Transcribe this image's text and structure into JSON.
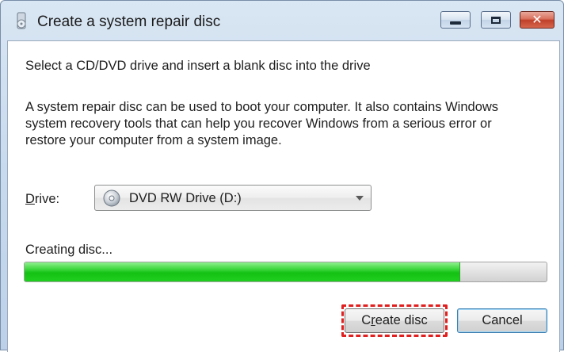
{
  "window": {
    "title": "Create a system repair disc",
    "icons": {
      "app": "disc-app-icon",
      "minimize": "minimize-icon",
      "maximize": "maximize-icon",
      "close": "close-icon"
    }
  },
  "content": {
    "heading": "Select a CD/DVD drive and insert a blank disc into the drive",
    "description": "A system repair disc can be used to boot your computer. It also contains Windows system recovery tools that can help you recover Windows from a serious error or restore your computer from a system image."
  },
  "drive": {
    "label_accel": "D",
    "label_rest": "rive:",
    "selected": "DVD RW Drive (D:)",
    "icon": "disc-drive-icon"
  },
  "progress": {
    "label": "Creating disc...",
    "fraction": 0.835
  },
  "buttons": {
    "create_prefix": "C",
    "create_accel": "r",
    "create_suffix": "eate disc",
    "cancel": "Cancel"
  },
  "colors": {
    "progress_fill": "#14c114",
    "highlight_border": "#e0201f"
  }
}
